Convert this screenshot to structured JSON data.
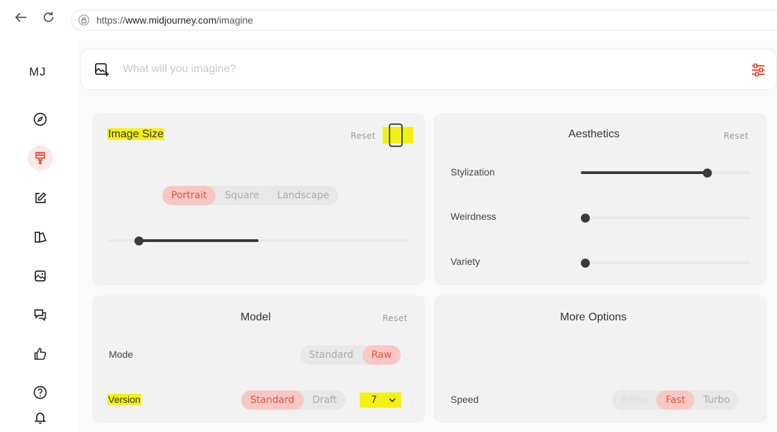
{
  "browser": {
    "back_icon": "arrow-left-icon",
    "reload_icon": "reload-icon",
    "url_prefix": "https://",
    "url_host": "www.midjourney.com",
    "url_path": "/imagine"
  },
  "sidebar": {
    "logo": "MJ",
    "items": [
      {
        "icon": "compass-icon",
        "name": "explore"
      },
      {
        "icon": "paintbrush-icon",
        "name": "create",
        "active": true
      },
      {
        "icon": "edit-icon",
        "name": "edit"
      },
      {
        "icon": "personalize-icon",
        "name": "personalize"
      },
      {
        "icon": "image-icon",
        "name": "organize"
      },
      {
        "icon": "chat-icon",
        "name": "chat"
      },
      {
        "icon": "thumbs-up-icon",
        "name": "tasks"
      },
      {
        "icon": "help-icon",
        "name": "help"
      },
      {
        "icon": "bell-icon",
        "name": "notifications"
      }
    ]
  },
  "prompt": {
    "placeholder": "What will you imagine?",
    "accent": "#e0523a"
  },
  "image_size": {
    "title": "Image Size",
    "reset": "Reset",
    "options": [
      "Portrait",
      "Square",
      "Landscape"
    ],
    "selected": "Portrait",
    "slider_value": 0.43
  },
  "aesthetics": {
    "title": "Aesthetics",
    "reset": "Reset",
    "sliders": [
      {
        "label": "Stylization",
        "value": 0.75
      },
      {
        "label": "Weirdness",
        "value": 0.0
      },
      {
        "label": "Variety",
        "value": 0.0
      }
    ]
  },
  "model": {
    "title": "Model",
    "reset": "Reset",
    "mode_label": "Mode",
    "mode_options": [
      "Standard",
      "Raw"
    ],
    "mode_selected": "Raw",
    "version_label": "Version",
    "version_options": [
      "Standard",
      "Draft"
    ],
    "version_selected": "Standard",
    "version_number": "7"
  },
  "more_options": {
    "title": "More Options",
    "speed_label": "Speed",
    "speed_options": [
      "Relax",
      "Fast",
      "Turbo"
    ],
    "speed_selected": "Fast"
  },
  "colors": {
    "highlight": "#f3f014",
    "selected_bg": "#f7c8c3",
    "selected_text": "#e0523a"
  }
}
